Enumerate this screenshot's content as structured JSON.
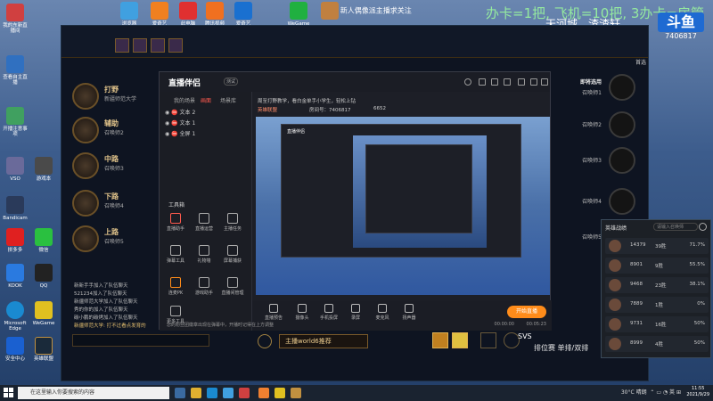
{
  "desktop": {
    "overlay_text": "办卡=1把, 飞机=10把, 3办卡=房管",
    "caster_name": "天河城、渣渣轩",
    "room_number": "7406817",
    "douyu_logo": "斗鱼",
    "left_icons": [
      {
        "label": "我的东新直播间"
      },
      {
        "label": "查看自主直播"
      },
      {
        "label": "开播注意事项"
      },
      {
        "label": "VSO"
      },
      {
        "label": "游戏本"
      },
      {
        "label": "Bandicam"
      },
      {
        "label": "拼多多"
      },
      {
        "label": "微信"
      },
      {
        "label": "KOOK"
      },
      {
        "label": "QQ"
      },
      {
        "label": "Microsoft Edge"
      },
      {
        "label": "WeGame"
      },
      {
        "label": "安全中心"
      },
      {
        "label": "英雄联盟"
      }
    ],
    "top_icons": [
      {
        "label": "浏览器"
      },
      {
        "label": "爱奇艺"
      },
      {
        "label": "此电脑"
      },
      {
        "label": "腾讯视频"
      },
      {
        "label": "爱奇艺"
      },
      {
        "label": "WeGame"
      },
      {
        "label": "新人偶像派主播求关注"
      }
    ]
  },
  "lol": {
    "search": "首选",
    "picks": [
      {
        "role": "打野",
        "sub": "新疆师范大学"
      },
      {
        "role": "辅助",
        "sub": "召唤师2"
      },
      {
        "role": "中路",
        "sub": "召唤师3"
      },
      {
        "role": "下路",
        "sub": "召唤师4"
      },
      {
        "role": "上路",
        "sub": "召唤师5"
      }
    ],
    "enemies": [
      {
        "label": "即将选用",
        "sub": "召唤师1"
      },
      {
        "label": "召唤师2"
      },
      {
        "label": "召唤师3"
      },
      {
        "label": "召唤师4"
      },
      {
        "label": "召唤师5"
      }
    ],
    "chat": [
      "新新手手加入了队伍聊天",
      "521234加入了队伍聊天",
      "新疆师范大学加入了队伍聊天",
      "秀的你的加入了队伍聊天",
      "碳小鹏的碳烤加入了队伍聊天",
      "新疆师范大学: 打不过看点发育的"
    ],
    "world_button": "主播world6推荐",
    "rank_mode": "SVS",
    "rank_label": "排位赛 单排/双排"
  },
  "app": {
    "brand": "直播伴侣",
    "badge": "测试",
    "tabs": [
      "我的场景",
      "画面",
      "场景库"
    ],
    "scenes": [
      "文本 2",
      "文本 1",
      "全屏 1"
    ],
    "tools_label": "工具箱",
    "tools": [
      "直播助手",
      "直播运营",
      "主播任务",
      "弹幕工具",
      "礼物墙",
      "屏幕捕获",
      "连麦PK",
      "游戏助手",
      "直播间管理",
      "更多工具"
    ],
    "stream_title": "周至打野教学，看白金单手小学生，轻松上钻",
    "stream_tag": "英雄联盟",
    "room_label": "房间号：7406817",
    "viewers": "6652",
    "controls": [
      "直播预告",
      "摄像头",
      "手机投屏",
      "录屏",
      "麦克风",
      "扬声器"
    ],
    "start_live": "开始直播",
    "footer": "您的粉丝团徽章出现在弹幕中，开播时记得在上方调整",
    "time_1": "00:00:00",
    "time_2": "00:05:23"
  },
  "rank_panel": {
    "title": "英雄战绩",
    "search": "请输入召唤师",
    "rows": [
      {
        "score": "14379",
        "wr": "39胜",
        "pct": "71.7%"
      },
      {
        "score": "8901",
        "wr": "9胜",
        "pct": "55.5%"
      },
      {
        "score": "9468",
        "wr": "23胜",
        "pct": "38.1%"
      },
      {
        "score": "7889",
        "wr": "1胜",
        "pct": "0%"
      },
      {
        "score": "9731",
        "wr": "16胜",
        "pct": "50%"
      },
      {
        "score": "8999",
        "wr": "4胜",
        "pct": "50%"
      }
    ]
  },
  "taskbar": {
    "search_placeholder": "在这里输入你要搜索的内容",
    "weather": "30°C 晴朗",
    "time": "11:55",
    "date": "2021/9/29"
  }
}
